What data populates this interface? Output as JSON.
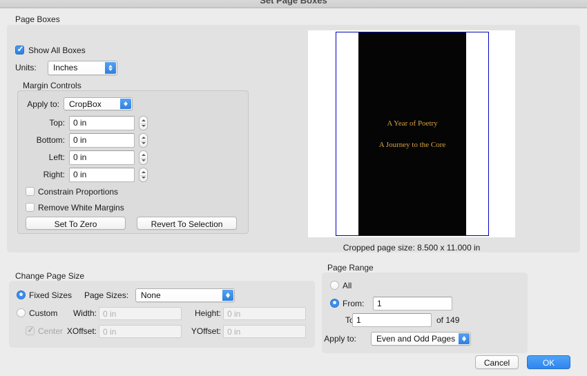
{
  "window": {
    "title": "Set Page Boxes"
  },
  "page_boxes": {
    "group_label": "Page Boxes",
    "show_all_boxes": {
      "label": "Show All Boxes",
      "checked": true
    },
    "units": {
      "label": "Units:",
      "value": "Inches"
    },
    "margin_controls": {
      "group_label": "Margin Controls",
      "apply_to": {
        "label": "Apply to:",
        "value": "CropBox"
      },
      "fields": [
        {
          "label": "Top:",
          "value": "0 in"
        },
        {
          "label": "Bottom:",
          "value": "0 in"
        },
        {
          "label": "Left:",
          "value": "0 in"
        },
        {
          "label": "Right:",
          "value": "0 in"
        }
      ],
      "constrain_proportions": {
        "label": "Constrain Proportions",
        "checked": false
      },
      "remove_white_margins": {
        "label": "Remove White Margins",
        "checked": false
      },
      "set_to_zero_label": "Set To Zero",
      "revert_to_selection_label": "Revert To Selection"
    }
  },
  "preview": {
    "document_title_line1": "A Year of Poetry",
    "document_title_line2": "A Journey to the Core",
    "cropped_page_size": "Cropped page size: 8.500 x 11.000 in",
    "page_border_color": "#0000bf",
    "page_background_color": "#050505",
    "document_text_color": "#d9a441"
  },
  "change_page_size": {
    "group_label": "Change Page Size",
    "fixed_sizes": {
      "label": "Fixed Sizes",
      "selected": true
    },
    "page_sizes": {
      "label": "Page Sizes:",
      "value": "None"
    },
    "custom": {
      "label": "Custom",
      "selected": false
    },
    "width": {
      "label": "Width:",
      "placeholder": "0 in"
    },
    "height": {
      "label": "Height:",
      "placeholder": "0 in"
    },
    "center": {
      "label": "Center",
      "checked": true,
      "disabled": true
    },
    "xoffset": {
      "label": "XOffset:",
      "placeholder": "0 in"
    },
    "yoffset": {
      "label": "YOffset:",
      "placeholder": "0 in"
    }
  },
  "page_range": {
    "group_label": "Page Range",
    "all": {
      "label": "All",
      "selected": false
    },
    "from": {
      "label": "From:",
      "value": "1",
      "selected": true
    },
    "to": {
      "label": "To:",
      "value": "1"
    },
    "of_total": "of 149",
    "apply_to": {
      "label": "Apply to:",
      "value": "Even and Odd Pages"
    }
  },
  "footer": {
    "cancel_label": "Cancel",
    "ok_label": "OK"
  },
  "theme": {
    "accent_blue": "#2f7fe0",
    "window_background": "#ececec"
  }
}
